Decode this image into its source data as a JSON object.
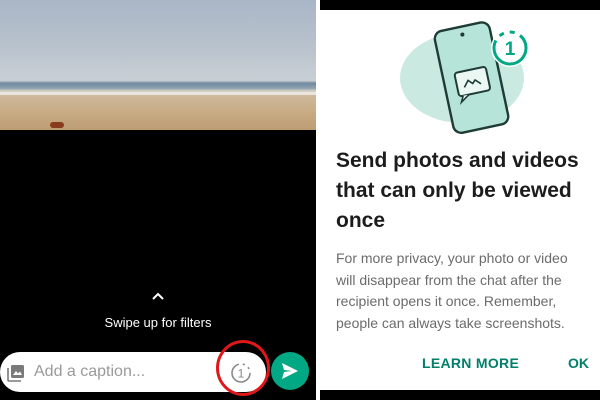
{
  "editor": {
    "swipe_hint": "Swipe up for filters",
    "caption_placeholder": "Add a caption...",
    "once_icon_label": "1",
    "icons": {
      "gallery": "gallery-icon",
      "swipe": "chevron-up-icon",
      "view_once": "view-once-icon",
      "send": "send-icon"
    },
    "colors": {
      "send": "#00a884",
      "highlight_ring": "#e0171a",
      "background": "#000000"
    }
  },
  "dialog": {
    "illustration_badge": "1",
    "title": "Send photos and videos that can only be viewed once",
    "body_lines": [
      "For more privacy, your photo or video",
      "will disappear from the chat after the",
      "recipient opens it once. Remember,",
      "people can always take screenshots."
    ],
    "learn_more_label": "LEARN MORE",
    "ok_label": "OK",
    "colors": {
      "accent": "#008069",
      "illustration_bg": "#c9e9e1",
      "phone": "#b7e4d8"
    }
  }
}
